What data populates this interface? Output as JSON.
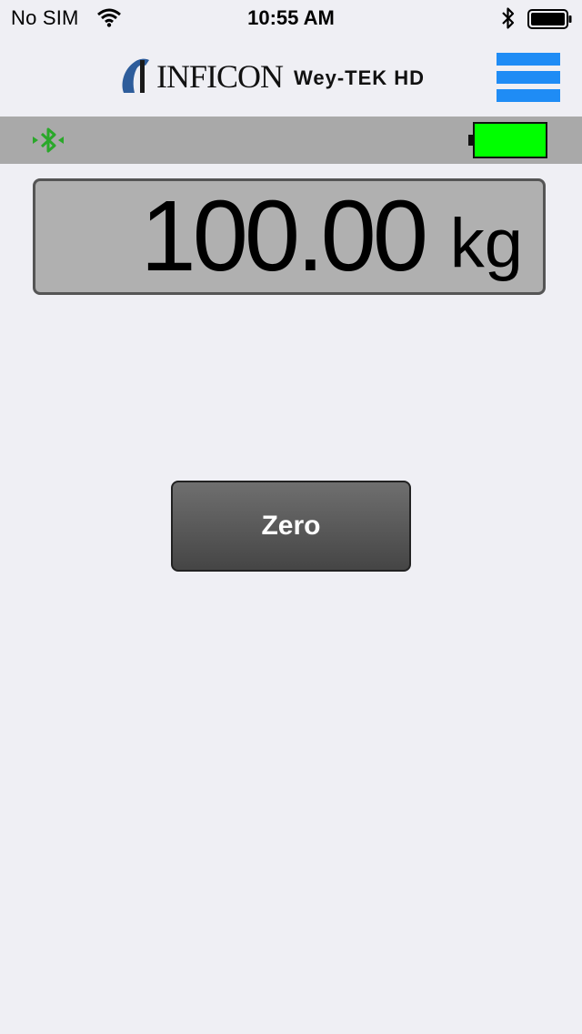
{
  "status_bar": {
    "carrier": "No SIM",
    "time": "10:55 AM",
    "icons": [
      "wifi-icon",
      "bluetooth-icon",
      "battery-icon"
    ]
  },
  "header": {
    "brand": "INFICON",
    "product": "Wey-TEK HD",
    "menu_icon": "hamburger-menu-icon",
    "menu_color": "#1f8cf5"
  },
  "device_status": {
    "bluetooth_icon": "bluetooth-connected-icon",
    "bluetooth_color": "#2aa82a",
    "battery_icon": "battery-full-icon",
    "battery_level": 1.0,
    "battery_color": "#00ff00"
  },
  "reading": {
    "value": "100.00",
    "unit": "kg"
  },
  "actions": {
    "zero_label": "Zero"
  }
}
